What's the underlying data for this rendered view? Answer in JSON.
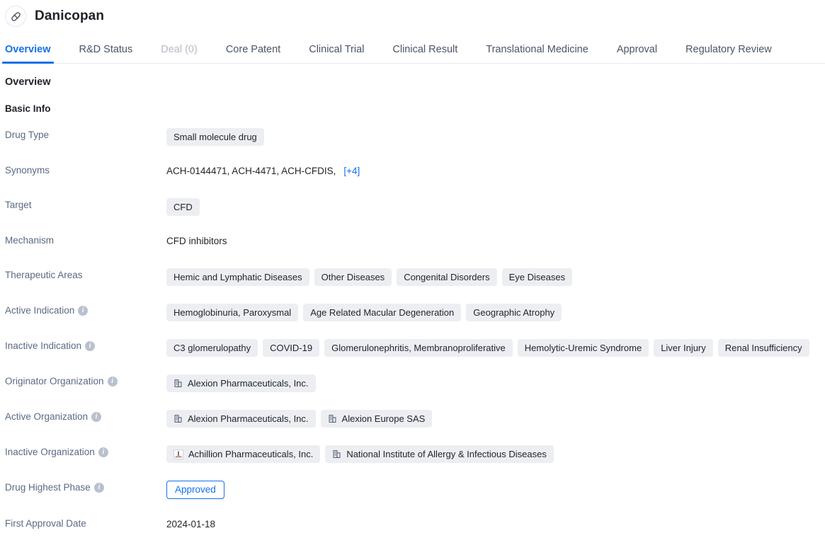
{
  "header": {
    "drug_name": "Danicopan",
    "avatar_icon": "pill-capsule-icon"
  },
  "tabs": [
    {
      "label": "Overview",
      "state": "active"
    },
    {
      "label": "R&D Status",
      "state": "normal"
    },
    {
      "label": "Deal (0)",
      "state": "disabled"
    },
    {
      "label": "Core Patent",
      "state": "normal"
    },
    {
      "label": "Clinical Trial",
      "state": "normal"
    },
    {
      "label": "Clinical Result",
      "state": "normal"
    },
    {
      "label": "Translational Medicine",
      "state": "normal"
    },
    {
      "label": "Approval",
      "state": "normal"
    },
    {
      "label": "Regulatory Review",
      "state": "normal"
    }
  ],
  "overview": {
    "section_title": "Overview",
    "subsection_title": "Basic Info",
    "drug_type": {
      "label": "Drug Type",
      "tags": [
        "Small molecule drug"
      ]
    },
    "synonyms": {
      "label": "Synonyms",
      "text": "ACH-0144471,  ACH-4471,  ACH-CFDIS,",
      "more": "[+4]"
    },
    "target": {
      "label": "Target",
      "tags": [
        "CFD"
      ]
    },
    "mechanism": {
      "label": "Mechanism",
      "value": "CFD inhibitors"
    },
    "therapeutic_areas": {
      "label": "Therapeutic Areas",
      "tags": [
        "Hemic and Lymphatic Diseases",
        "Other Diseases",
        "Congenital Disorders",
        "Eye Diseases"
      ]
    },
    "active_indication": {
      "label": "Active Indication",
      "has_info": true,
      "tags": [
        "Hemoglobinuria, Paroxysmal",
        "Age Related Macular Degeneration",
        "Geographic Atrophy"
      ]
    },
    "inactive_indication": {
      "label": "Inactive Indication",
      "has_info": true,
      "tags": [
        "C3 glomerulopathy",
        "COVID-19",
        "Glomerulonephritis, Membranoproliferative",
        "Hemolytic-Uremic Syndrome",
        "Liver Injury",
        "Renal Insufficiency"
      ]
    },
    "originator_organization": {
      "label": "Originator Organization",
      "has_info": true,
      "orgs": [
        {
          "name": "Alexion Pharmaceuticals, Inc.",
          "icon": "building-icon"
        }
      ]
    },
    "active_organization": {
      "label": "Active Organization",
      "has_info": true,
      "orgs": [
        {
          "name": "Alexion Pharmaceuticals, Inc.",
          "icon": "building-icon"
        },
        {
          "name": "Alexion Europe SAS",
          "icon": "building-icon"
        }
      ]
    },
    "inactive_organization": {
      "label": "Inactive Organization",
      "has_info": true,
      "orgs": [
        {
          "name": "Achillion Pharmaceuticals, Inc.",
          "icon": "company-logo-icon"
        },
        {
          "name": "National Institute of Allergy & Infectious Diseases",
          "icon": "building-icon"
        }
      ]
    },
    "drug_highest_phase": {
      "label": "Drug Highest Phase",
      "has_info": true,
      "badge": "Approved"
    },
    "first_approval_date": {
      "label": "First Approval Date",
      "value": "2024-01-18"
    }
  },
  "colors": {
    "accent": "#1371e8",
    "tag_bg": "#eceef2",
    "label": "#5a6a85",
    "text": "#1f2329",
    "disabled": "#b4bac4"
  }
}
